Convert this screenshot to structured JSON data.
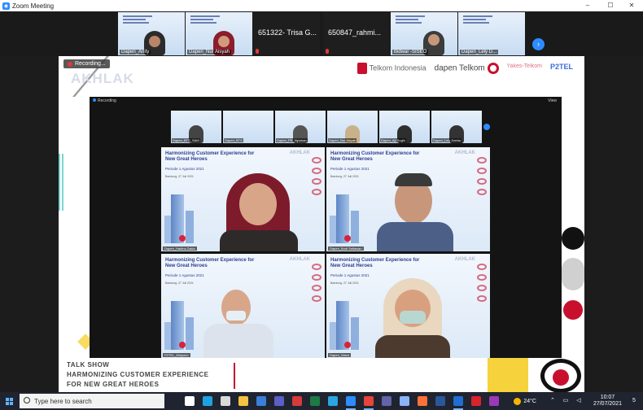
{
  "window": {
    "title": "Zoom Meeting",
    "minimize": "–",
    "maximize": "☐",
    "close": "✕"
  },
  "gallery": {
    "tiles": [
      {
        "name": "Dapen_Anity",
        "type": "video",
        "skin": "#3b2c2a",
        "hijab": "#2b2b2b"
      },
      {
        "name": "Dapen_Nur Aisyah",
        "type": "video",
        "skin": "#c78b6e",
        "hijab": "#8c1d2a"
      },
      {
        "name": "651322- Trisa G...",
        "type": "text"
      },
      {
        "name": "650847_rahmi...",
        "type": "text"
      },
      {
        "name": "Bidwar -SISEO",
        "type": "video",
        "skin": "#c6977b",
        "hijab": "#333"
      },
      {
        "name": "Dapen_Lely D...",
        "type": "video",
        "skin": "#c6977b",
        "hijab": "#2e2e2e"
      }
    ],
    "next_icon": "›"
  },
  "share": {
    "recording_label": "Recording...",
    "akhlak_logo": "AKHLAK",
    "logos": {
      "telkom": "Telkom Indonesia",
      "dapen": "dapen Telkom",
      "yakes": "Yakes-Telkom",
      "p2tel": "P2TEL"
    },
    "inner_bar": {
      "recording": "Recording",
      "view": "View"
    },
    "inner_strip": [
      {
        "name": "Dapen_BTS_SAM"
      },
      {
        "name": "Dapen_BTS"
      },
      {
        "name": "Dapen_PR_Nyoman"
      },
      {
        "name": "Dapen_Nur Aisyah"
      },
      {
        "name": "Dapen_Aji Sugih"
      },
      {
        "name": "Dapen_Lely Dahlia"
      }
    ],
    "slide": {
      "title": "Harmonizing Customer Experience for New Great Heroes",
      "period": "Periode 1 Agustus 2021",
      "date": "Bandung, 27 Juli 2021",
      "brand": "AKHLAK"
    },
    "videos": [
      {
        "name": "Dapen_Hadina Zakia"
      },
      {
        "name": "Dapen_Budi Setiawan"
      },
      {
        "name": "P2TEL_Mulyono"
      },
      {
        "name": "Dapen_Warni"
      }
    ],
    "talkshow": {
      "line1": "TALK SHOW",
      "line2": "HARMONIZING CUSTOMER EXPERIENCE",
      "line3": "FOR NEW GREAT HEROES"
    }
  },
  "taskbar": {
    "search_placeholder": "Type here to search",
    "weather": "24°C",
    "time": "10:07",
    "date": "27/07/2021",
    "notifications": "5",
    "apps": [
      {
        "name": "task-view",
        "color": "#ffffff"
      },
      {
        "name": "edge",
        "color": "#1fa3e0"
      },
      {
        "name": "store",
        "color": "#d9d9d9"
      },
      {
        "name": "file-explorer",
        "color": "#f5c242"
      },
      {
        "name": "mail",
        "color": "#3b7fd8"
      },
      {
        "name": "teams",
        "color": "#5b5fc7"
      },
      {
        "name": "snip",
        "color": "#d63b3b"
      },
      {
        "name": "excel",
        "color": "#1d7a43"
      },
      {
        "name": "telegram",
        "color": "#2ca5e0"
      },
      {
        "name": "zoom",
        "color": "#2d8cff"
      },
      {
        "name": "chrome",
        "color": "#e5453a"
      },
      {
        "name": "teams2",
        "color": "#6264a7"
      },
      {
        "name": "settings",
        "color": "#8ab4f8"
      },
      {
        "name": "firefox",
        "color": "#ff7139"
      },
      {
        "name": "word",
        "color": "#2b579a"
      },
      {
        "name": "photos",
        "color": "#1f6ed4"
      },
      {
        "name": "acrobat",
        "color": "#d9232d"
      },
      {
        "name": "winrar",
        "color": "#9a3ab8"
      }
    ]
  }
}
